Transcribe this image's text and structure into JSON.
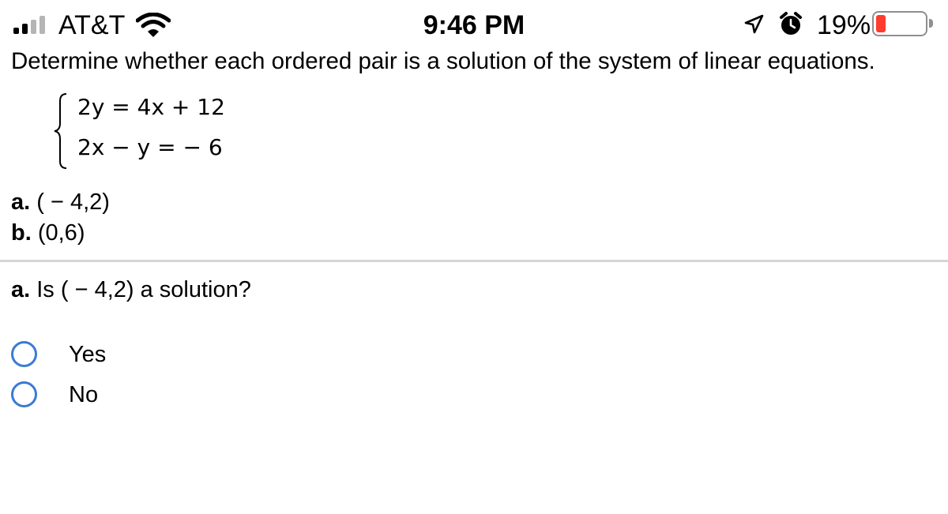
{
  "status_bar": {
    "carrier": "AT&T",
    "time": "9:46 PM",
    "battery_percent": "19%",
    "battery_level": 0.19,
    "battery_color": "#ff3b30",
    "signal_bars_active": 2,
    "signal_bars_total": 4,
    "icons": [
      "signal-icon",
      "wifi-icon",
      "location-arrow-icon",
      "alarm-clock-icon",
      "battery-icon"
    ]
  },
  "problem": {
    "instruction": "Determine whether each ordered pair is a solution of the system of linear equations.",
    "equations": [
      "2y = 4x + 12",
      "2x − y = − 6"
    ],
    "pairs": [
      {
        "letter": "a.",
        "value": "( − 4,2)"
      },
      {
        "letter": "b.",
        "value": "(0,6)"
      }
    ]
  },
  "question": {
    "letter": "a.",
    "text": "Is ( − 4,2) a solution?",
    "options": [
      {
        "label": "Yes",
        "selected": false
      },
      {
        "label": "No",
        "selected": false
      }
    ]
  },
  "colors": {
    "radio_border": "#3a7bd5",
    "divider": "#d6d6d6"
  }
}
